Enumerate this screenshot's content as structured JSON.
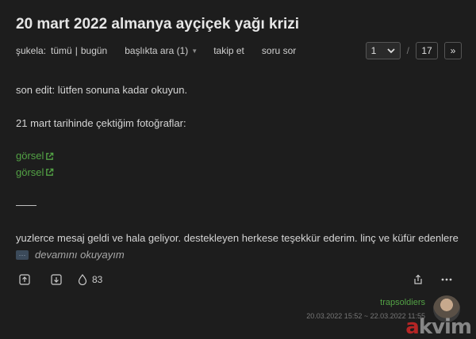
{
  "topic": {
    "title": "20 mart 2022 almanya ayçiçek yağı krizi"
  },
  "subnav": {
    "sukela_label": "şukela:",
    "filter_all": "tümü",
    "separator": "|",
    "filter_today": "bugün",
    "search_in_title": "başlıkta ara (1)",
    "follow": "takip et",
    "ask_question": "soru sor"
  },
  "pager": {
    "current": "1",
    "slash": "/",
    "total": "17",
    "next": "»"
  },
  "entry": {
    "line1": "son edit: lütfen sonuna kadar okuyun.",
    "line2": "21 mart tarihinde çektiğim fotoğraflar:",
    "link1": "görsel",
    "link2": "görsel",
    "dash": "——",
    "line3": "yuzlerce mesaj geldi ve hala geliyor. destekleyen herkese teşekkür ederim. linç ve küfür edenlere",
    "read_more": "devamını okuyayım"
  },
  "actions": {
    "favorite_count": "83"
  },
  "meta": {
    "author": "trapsoldiers",
    "date": "20.03.2022 15:52 ~ 22.03.2022 11:55"
  },
  "watermark": {
    "prefix": "",
    "highlight": "a",
    "rest": "kvim"
  },
  "colors": {
    "link_green": "#53a245",
    "background": "#1d1d1d",
    "text": "#d5d5d5"
  },
  "icons": [
    "external-link-icon",
    "arrow-up-icon",
    "arrow-down-icon",
    "drop-icon",
    "share-icon",
    "more-icon",
    "chevron-down-icon"
  ]
}
